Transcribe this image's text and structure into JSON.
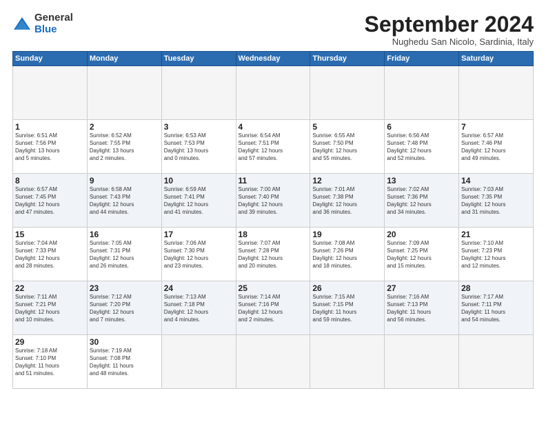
{
  "logo": {
    "general": "General",
    "blue": "Blue"
  },
  "title": "September 2024",
  "subtitle": "Nughedu San Nicolo, Sardinia, Italy",
  "headers": [
    "Sunday",
    "Monday",
    "Tuesday",
    "Wednesday",
    "Thursday",
    "Friday",
    "Saturday"
  ],
  "days": [
    {
      "num": "",
      "info": ""
    },
    {
      "num": "",
      "info": ""
    },
    {
      "num": "",
      "info": ""
    },
    {
      "num": "",
      "info": ""
    },
    {
      "num": "",
      "info": ""
    },
    {
      "num": "",
      "info": ""
    },
    {
      "num": "",
      "info": ""
    },
    {
      "num": "1",
      "info": "Sunrise: 6:51 AM\nSunset: 7:56 PM\nDaylight: 13 hours\nand 5 minutes."
    },
    {
      "num": "2",
      "info": "Sunrise: 6:52 AM\nSunset: 7:55 PM\nDaylight: 13 hours\nand 2 minutes."
    },
    {
      "num": "3",
      "info": "Sunrise: 6:53 AM\nSunset: 7:53 PM\nDaylight: 13 hours\nand 0 minutes."
    },
    {
      "num": "4",
      "info": "Sunrise: 6:54 AM\nSunset: 7:51 PM\nDaylight: 12 hours\nand 57 minutes."
    },
    {
      "num": "5",
      "info": "Sunrise: 6:55 AM\nSunset: 7:50 PM\nDaylight: 12 hours\nand 55 minutes."
    },
    {
      "num": "6",
      "info": "Sunrise: 6:56 AM\nSunset: 7:48 PM\nDaylight: 12 hours\nand 52 minutes."
    },
    {
      "num": "7",
      "info": "Sunrise: 6:57 AM\nSunset: 7:46 PM\nDaylight: 12 hours\nand 49 minutes."
    },
    {
      "num": "8",
      "info": "Sunrise: 6:57 AM\nSunset: 7:45 PM\nDaylight: 12 hours\nand 47 minutes."
    },
    {
      "num": "9",
      "info": "Sunrise: 6:58 AM\nSunset: 7:43 PM\nDaylight: 12 hours\nand 44 minutes."
    },
    {
      "num": "10",
      "info": "Sunrise: 6:59 AM\nSunset: 7:41 PM\nDaylight: 12 hours\nand 41 minutes."
    },
    {
      "num": "11",
      "info": "Sunrise: 7:00 AM\nSunset: 7:40 PM\nDaylight: 12 hours\nand 39 minutes."
    },
    {
      "num": "12",
      "info": "Sunrise: 7:01 AM\nSunset: 7:38 PM\nDaylight: 12 hours\nand 36 minutes."
    },
    {
      "num": "13",
      "info": "Sunrise: 7:02 AM\nSunset: 7:36 PM\nDaylight: 12 hours\nand 34 minutes."
    },
    {
      "num": "14",
      "info": "Sunrise: 7:03 AM\nSunset: 7:35 PM\nDaylight: 12 hours\nand 31 minutes."
    },
    {
      "num": "15",
      "info": "Sunrise: 7:04 AM\nSunset: 7:33 PM\nDaylight: 12 hours\nand 28 minutes."
    },
    {
      "num": "16",
      "info": "Sunrise: 7:05 AM\nSunset: 7:31 PM\nDaylight: 12 hours\nand 26 minutes."
    },
    {
      "num": "17",
      "info": "Sunrise: 7:06 AM\nSunset: 7:30 PM\nDaylight: 12 hours\nand 23 minutes."
    },
    {
      "num": "18",
      "info": "Sunrise: 7:07 AM\nSunset: 7:28 PM\nDaylight: 12 hours\nand 20 minutes."
    },
    {
      "num": "19",
      "info": "Sunrise: 7:08 AM\nSunset: 7:26 PM\nDaylight: 12 hours\nand 18 minutes."
    },
    {
      "num": "20",
      "info": "Sunrise: 7:09 AM\nSunset: 7:25 PM\nDaylight: 12 hours\nand 15 minutes."
    },
    {
      "num": "21",
      "info": "Sunrise: 7:10 AM\nSunset: 7:23 PM\nDaylight: 12 hours\nand 12 minutes."
    },
    {
      "num": "22",
      "info": "Sunrise: 7:11 AM\nSunset: 7:21 PM\nDaylight: 12 hours\nand 10 minutes."
    },
    {
      "num": "23",
      "info": "Sunrise: 7:12 AM\nSunset: 7:20 PM\nDaylight: 12 hours\nand 7 minutes."
    },
    {
      "num": "24",
      "info": "Sunrise: 7:13 AM\nSunset: 7:18 PM\nDaylight: 12 hours\nand 4 minutes."
    },
    {
      "num": "25",
      "info": "Sunrise: 7:14 AM\nSunset: 7:16 PM\nDaylight: 12 hours\nand 2 minutes."
    },
    {
      "num": "26",
      "info": "Sunrise: 7:15 AM\nSunset: 7:15 PM\nDaylight: 11 hours\nand 59 minutes."
    },
    {
      "num": "27",
      "info": "Sunrise: 7:16 AM\nSunset: 7:13 PM\nDaylight: 11 hours\nand 56 minutes."
    },
    {
      "num": "28",
      "info": "Sunrise: 7:17 AM\nSunset: 7:11 PM\nDaylight: 11 hours\nand 54 minutes."
    },
    {
      "num": "29",
      "info": "Sunrise: 7:18 AM\nSunset: 7:10 PM\nDaylight: 11 hours\nand 51 minutes."
    },
    {
      "num": "30",
      "info": "Sunrise: 7:19 AM\nSunset: 7:08 PM\nDaylight: 11 hours\nand 48 minutes."
    },
    {
      "num": "",
      "info": ""
    },
    {
      "num": "",
      "info": ""
    },
    {
      "num": "",
      "info": ""
    },
    {
      "num": "",
      "info": ""
    },
    {
      "num": "",
      "info": ""
    }
  ]
}
